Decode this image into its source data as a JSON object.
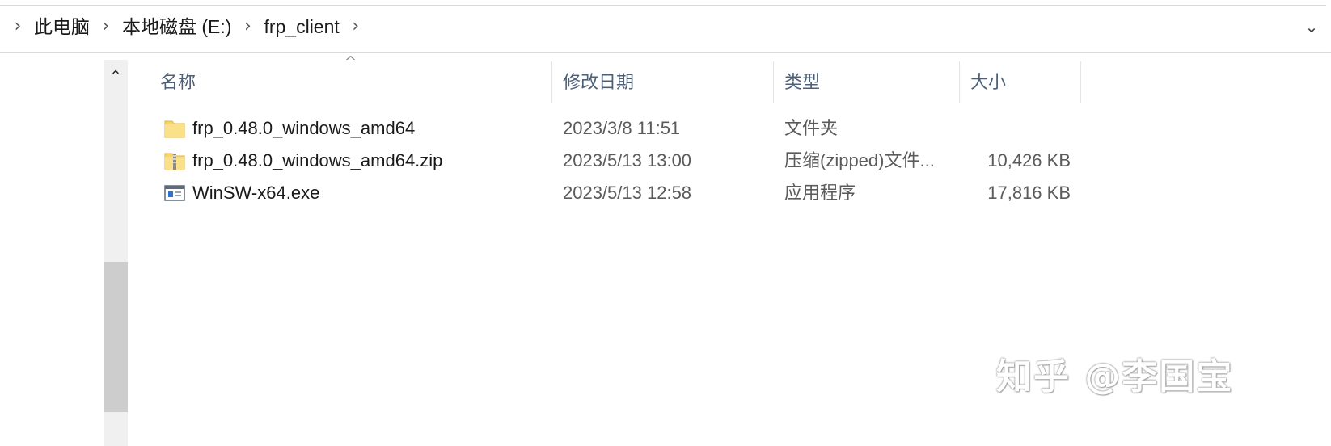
{
  "address_bar": {
    "breadcrumbs": [
      "此电脑",
      "本地磁盘 (E:)",
      "frp_client"
    ],
    "separator_icon": "chevron-right-icon",
    "dropdown_icon": "chevron-down-icon"
  },
  "columns": {
    "name": "名称",
    "modified": "修改日期",
    "type": "类型",
    "size": "大小",
    "sort_icon": "sort-ascending-icon"
  },
  "files": [
    {
      "name": "frp_0.48.0_windows_amd64",
      "modified": "2023/3/8 11:51",
      "type": "文件夹",
      "size": "",
      "icon": "folder-icon"
    },
    {
      "name": "frp_0.48.0_windows_amd64.zip",
      "modified": "2023/5/13 13:00",
      "type": "压缩(zipped)文件...",
      "size": "10,426 KB",
      "icon": "zip-folder-icon"
    },
    {
      "name": "WinSW-x64.exe",
      "modified": "2023/5/13 12:58",
      "type": "应用程序",
      "size": "17,816 KB",
      "icon": "application-icon"
    }
  ],
  "watermark": "知乎 @李国宝",
  "colors": {
    "header_text": "#4c607a",
    "folder_yellow": "#f7d56b",
    "scrollbar_thumb": "#cdcdcd"
  }
}
